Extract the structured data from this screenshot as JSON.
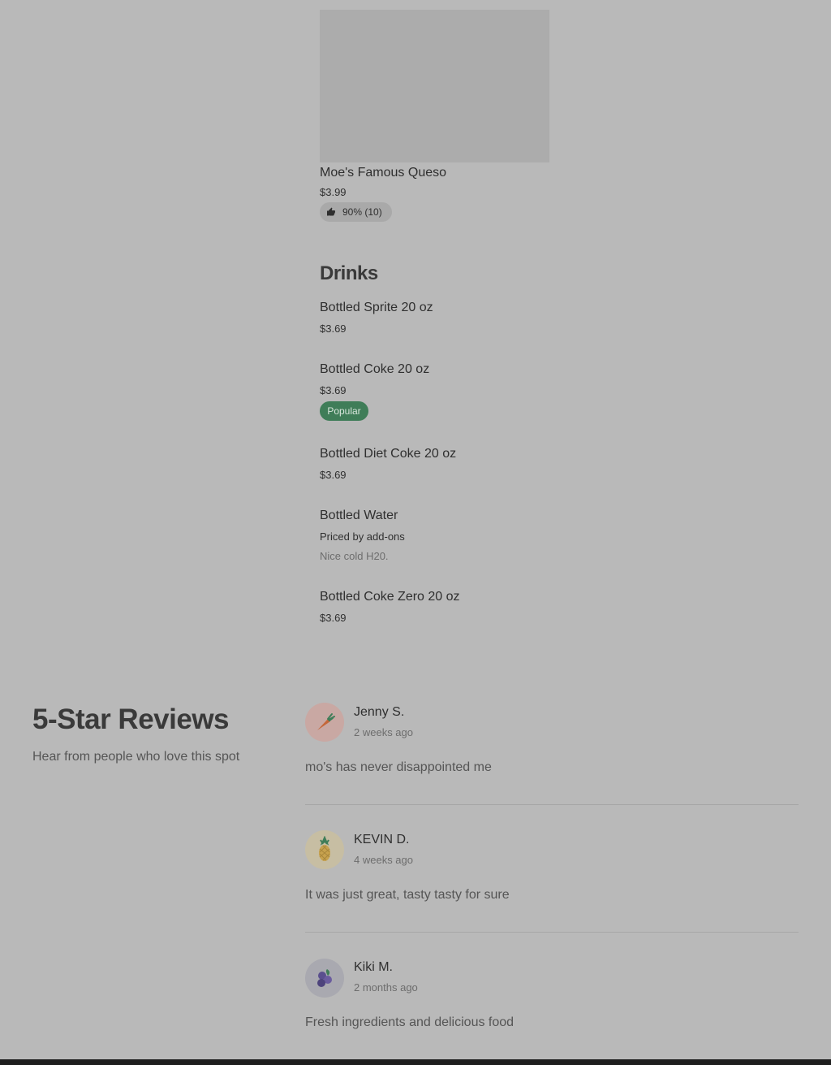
{
  "featured_item": {
    "title": "Moe's Famous Queso",
    "price": "$3.99",
    "rating": "90% (10)"
  },
  "drinks_section": {
    "heading": "Drinks",
    "items": [
      {
        "title": "Bottled Sprite 20 oz",
        "price": "$3.69"
      },
      {
        "title": "Bottled Coke 20 oz",
        "price": "$3.69",
        "badge": "Popular"
      },
      {
        "title": "Bottled Diet Coke 20 oz",
        "price": "$3.69"
      },
      {
        "title": "Bottled Water",
        "price": "Priced by add-ons",
        "description": "Nice cold H20."
      },
      {
        "title": "Bottled Coke Zero 20 oz",
        "price": "$3.69"
      }
    ]
  },
  "reviews": {
    "title": "5-Star Reviews",
    "subtitle": "Hear from people who love this spot",
    "items": [
      {
        "name": "Jenny S.",
        "date": "2 weeks ago",
        "text": "mo's has never disappointed me",
        "avatar_icon": "carrot-icon"
      },
      {
        "name": "KEVIN D.",
        "date": "4 weeks ago",
        "text": "It was just great, tasty tasty for sure",
        "avatar_icon": "pineapple-icon"
      },
      {
        "name": "Kiki M.",
        "date": "2 months ago",
        "text": "Fresh ingredients and delicious food",
        "avatar_icon": "blueberry-icon"
      }
    ]
  },
  "colors": {
    "popular_badge": "#3f7d58",
    "overlay_background": "#b9b9b9"
  }
}
